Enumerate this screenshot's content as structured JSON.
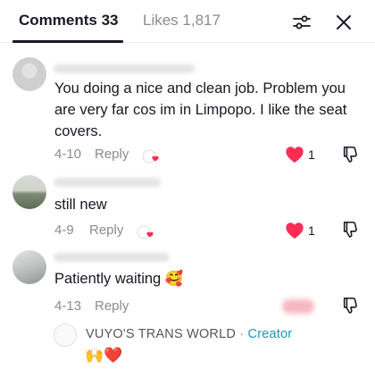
{
  "tabs": {
    "comments_label": "Comments 33",
    "likes_label": "Likes 1,817"
  },
  "icons": {
    "filter": "sliders-icon",
    "close": "close-icon",
    "heart": "heart-icon",
    "dislike": "thumb-down-icon"
  },
  "colors": {
    "heart": "#fe2c55",
    "creator": "#1a9bb6",
    "muted": "#8a8b91"
  },
  "comments": [
    {
      "text": "You doing a nice and clean job. Problem you are very far cos im in Limpopo. I like the seat covers.",
      "date": "4-10",
      "reply_label": "Reply",
      "likes": "1"
    },
    {
      "text": "still new",
      "date": "4-9",
      "reply_label": "Reply",
      "likes": "1"
    },
    {
      "text": "Patiently waiting 🥰",
      "date": "4-13",
      "reply_label": "Reply"
    }
  ],
  "reply": {
    "author": "VUYO'S TRANS WORLD",
    "separator": "·",
    "badge": "Creator",
    "text": "🙌❤️"
  }
}
